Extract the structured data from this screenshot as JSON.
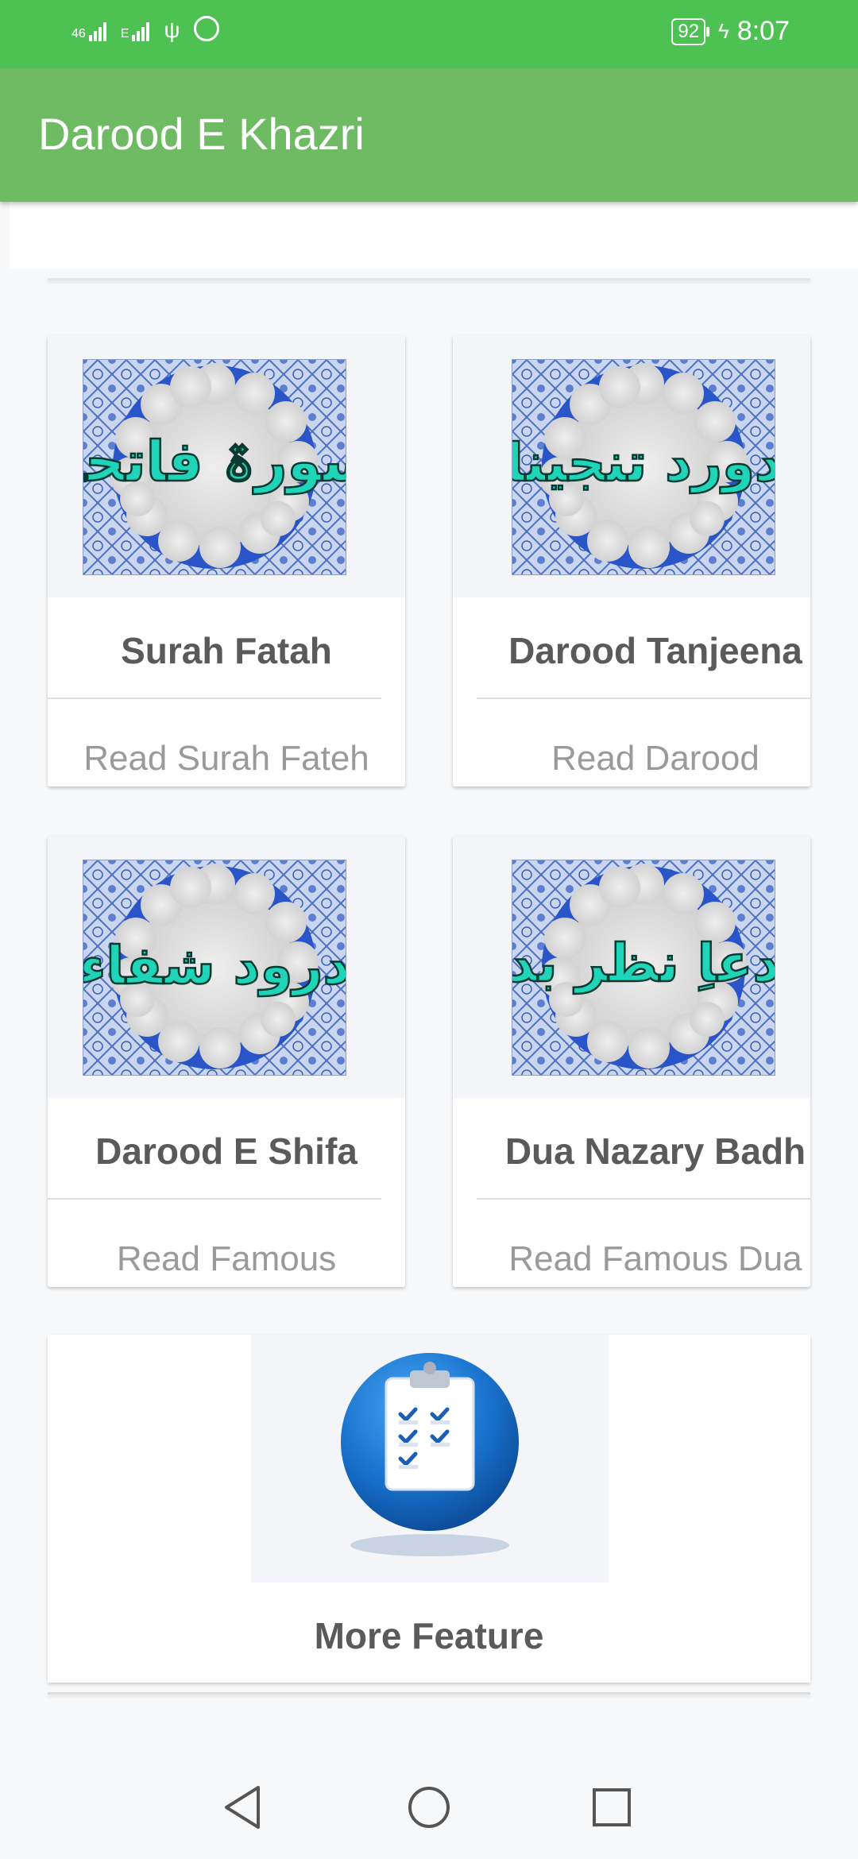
{
  "status_bar": {
    "network1": "46",
    "network2": "E",
    "battery": "92",
    "time": "8:07"
  },
  "app_bar": {
    "title": "Darood E Khazri"
  },
  "cards": [
    {
      "title": "Surah Fatah",
      "subtitle": "Read Surah Fateh",
      "tile_text": "سورۃ فاتحہ"
    },
    {
      "title": "Darood Tanjeena",
      "subtitle": "Read Darood",
      "tile_text": "دورد تنجینا"
    },
    {
      "title": "Darood E Shifa",
      "subtitle": "Read Famous",
      "tile_text": "درود شفاء"
    },
    {
      "title": "Dua Nazary Badh",
      "subtitle": "Read Famous Dua",
      "tile_text": "دعاِ نظر بد"
    }
  ],
  "more": {
    "title": "More Feature",
    "icon": "clipboard-checklist-icon"
  },
  "nav": {
    "back": "back-icon",
    "home": "home-icon",
    "recents": "recents-icon"
  },
  "colors": {
    "status_bar": "#4dc253",
    "app_bar": "#6fbb63",
    "tile_blue": "#2a55c8",
    "calligraphy": "#1fd4b8"
  }
}
